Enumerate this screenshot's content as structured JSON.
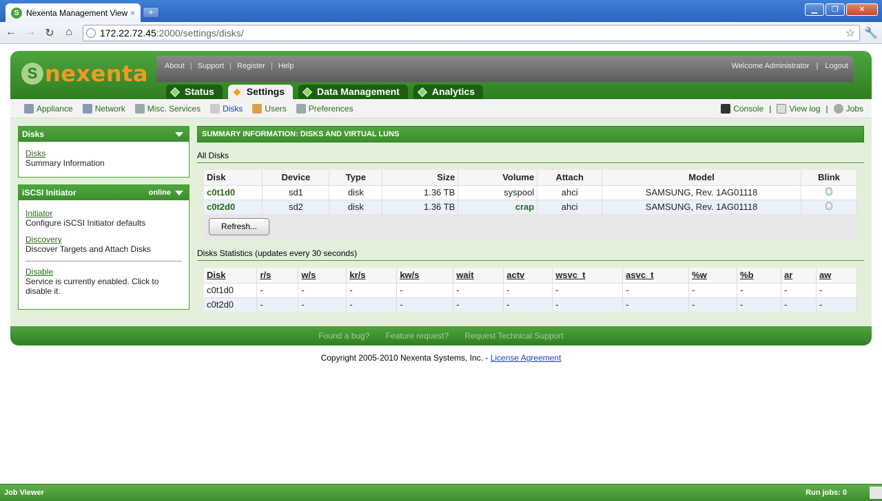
{
  "browser": {
    "tab_title": "Nexenta Management View:...",
    "tab_close": "×",
    "new_tab": "+",
    "url_host": "172.22.72.45",
    "url_path": ":2000/settings/disks/",
    "min": "▁",
    "max": "❐",
    "close": "✕"
  },
  "header": {
    "logo": "nexenta",
    "top_links": [
      "About",
      "Support",
      "Register",
      "Help"
    ],
    "welcome": "Welcome Administrator",
    "logout": "Logout",
    "tabs": [
      "Status",
      "Settings",
      "Data Management",
      "Analytics"
    ]
  },
  "subnav": {
    "items": [
      "Appliance",
      "Network",
      "Misc. Services",
      "Disks",
      "Users",
      "Preferences"
    ],
    "right": [
      "Console",
      "View log",
      "Jobs"
    ]
  },
  "sidebar": {
    "disks_panel": {
      "title": "Disks",
      "link": "Disks",
      "desc": "Summary Information"
    },
    "iscsi_panel": {
      "title": "iSCSI Initiator",
      "status": "online",
      "items": [
        {
          "link": "Initiator",
          "desc": "Configure iSCSI Initiator defaults"
        },
        {
          "link": "Discovery",
          "desc": "Discover Targets and Attach Disks"
        },
        {
          "link": "Disable",
          "desc": "Service is currently enabled. Click to disable it."
        }
      ]
    }
  },
  "main": {
    "summary_title": "SUMMARY INFORMATION: DISKS AND VIRTUAL LUNS",
    "all_disks_title": "All Disks",
    "disk_columns": [
      "Disk",
      "Device",
      "Type",
      "Size",
      "Volume",
      "Attach",
      "Model",
      "Blink"
    ],
    "disks": [
      {
        "disk": "c0t1d0",
        "device": "sd1",
        "type": "disk",
        "size": "1.36 TB",
        "volume": "syspool",
        "attach": "ahci",
        "model": "SAMSUNG, Rev. 1AG01118"
      },
      {
        "disk": "c0t2d0",
        "device": "sd2",
        "type": "disk",
        "size": "1.36 TB",
        "volume": "crap",
        "attach": "ahci",
        "model": "SAMSUNG, Rev. 1AG01118"
      }
    ],
    "refresh_label": "Refresh...",
    "stats_title": "Disks Statistics (updates every 30 seconds)",
    "stats_columns": [
      "Disk",
      "r/s",
      "w/s",
      "kr/s",
      "kw/s",
      "wait",
      "actv",
      "wsvc_t",
      "asvc_t",
      "%w",
      "%b",
      "ar",
      "aw"
    ],
    "stats": [
      {
        "disk": "c0t1d0",
        "values": [
          "-",
          "-",
          "-",
          "-",
          "-",
          "-",
          "-",
          "-",
          "-",
          "-",
          "-",
          "-"
        ]
      },
      {
        "disk": "c0t2d0",
        "values": [
          "-",
          "-",
          "-",
          "-",
          "-",
          "-",
          "-",
          "-",
          "-",
          "-",
          "-",
          "-"
        ]
      }
    ]
  },
  "footer": {
    "links": [
      "Found a bug?",
      "Feature request?",
      "Request Technical Support"
    ],
    "copyright": "Copyright 2005-2010 Nexenta Systems, Inc. -",
    "license": "License Agreement"
  },
  "jobbar": {
    "left": "Job Viewer",
    "right": "Run jobs: 0"
  }
}
